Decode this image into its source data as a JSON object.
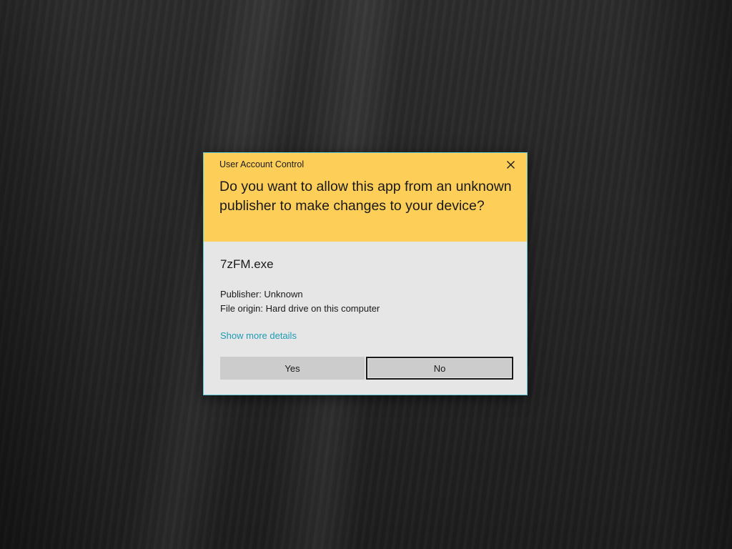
{
  "dialog": {
    "title": "User Account Control",
    "question": "Do you want to allow this app from an unknown publisher to make changes to your device?",
    "app_name": "7zFM.exe",
    "publisher": "Publisher: Unknown",
    "file_origin": "File origin: Hard drive on this computer",
    "more_details_link": "Show more details",
    "yes_label": "Yes",
    "no_label": "No",
    "close_icon": "close-icon"
  },
  "colors": {
    "header_background": "#fdcf59",
    "body_background": "#e6e6e6",
    "border_accent": "#5fc4d4",
    "link": "#1f9bb5",
    "button_background": "#cccccc"
  }
}
